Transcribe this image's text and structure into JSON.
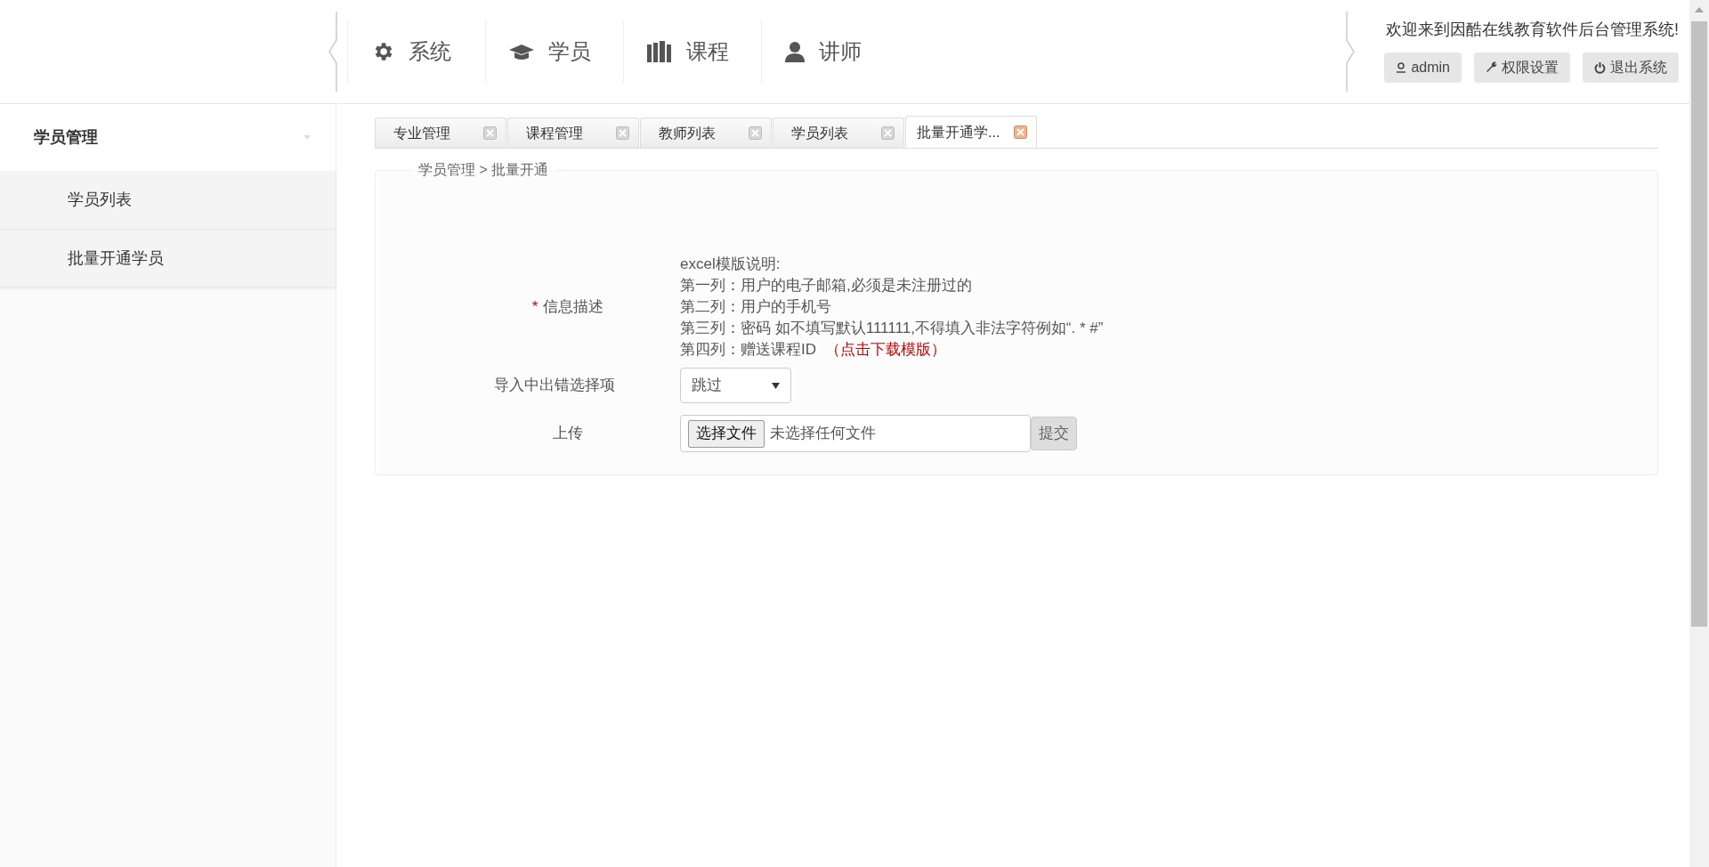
{
  "nav": [
    {
      "kind": "gear",
      "label": "系统"
    },
    {
      "kind": "cap",
      "label": "学员"
    },
    {
      "kind": "books",
      "label": "课程"
    },
    {
      "kind": "person",
      "label": "讲师"
    }
  ],
  "welcome": "欢迎来到因酷在线教育软件后台管理系统!",
  "header_buttons": [
    {
      "kind": "user",
      "label": "admin"
    },
    {
      "kind": "wrench",
      "label": "权限设置"
    },
    {
      "kind": "power",
      "label": "退出系统"
    }
  ],
  "sidebar": {
    "title": "学员管理",
    "items": [
      {
        "label": "学员列表"
      },
      {
        "label": "批量开通学员"
      }
    ]
  },
  "tabs": [
    {
      "label": "专业管理",
      "selected": false
    },
    {
      "label": "课程管理",
      "selected": false
    },
    {
      "label": "教师列表",
      "selected": false
    },
    {
      "label": "学员列表",
      "selected": false
    },
    {
      "label": "批量开通学...",
      "selected": true
    }
  ],
  "breadcrumb": "学员管理 > 批量开通",
  "form": {
    "description_label": "信息描述",
    "required_mark": "*",
    "description_lines": [
      "excel模版说明:",
      "第一列：用户的电子邮箱,必须是未注册过的",
      "第二列：用户的手机号",
      "第三列：密码 如不填写默认111111,不得填入非法字符例如“. * #”",
      "第四列：赠送课程ID"
    ],
    "download_link": "（点击下载模版）",
    "error_label": "导入中出错选择项",
    "error_select": "跳过",
    "upload_label": "上传",
    "file_button": "选择文件",
    "file_status": "未选择任何文件",
    "submit": "提交"
  }
}
